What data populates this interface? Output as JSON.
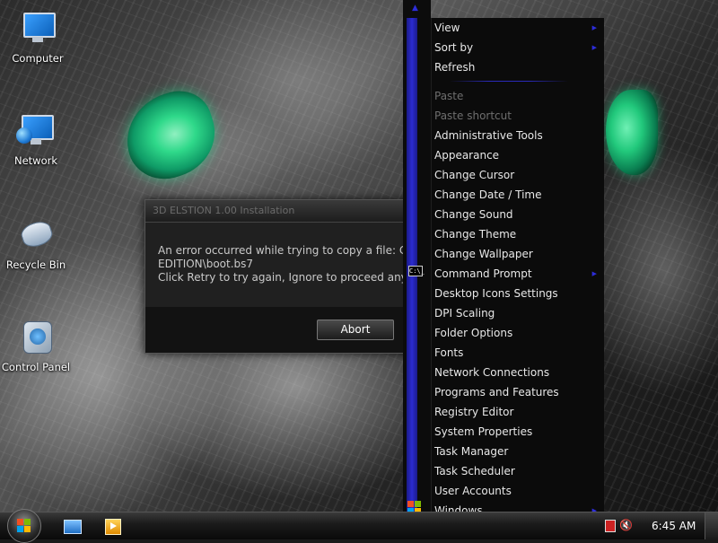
{
  "desktop": {
    "icons": [
      {
        "label": "Computer"
      },
      {
        "label": "Network"
      },
      {
        "label": "Recycle Bin"
      },
      {
        "label": "Control Panel"
      }
    ]
  },
  "dialog": {
    "title": "3D ELSTION 1.00 Installation",
    "message_line1": "An error occurred while trying to copy a file: C:\\Prog",
    "message_line2": "EDITION\\boot.bs7",
    "message_line3": "Click Retry to try again, Ignore to proceed anyway, o",
    "abort_label": "Abort"
  },
  "context_menu": {
    "items": [
      {
        "label": "View",
        "submenu": true,
        "enabled": true
      },
      {
        "label": "Sort by",
        "submenu": true,
        "enabled": true
      },
      {
        "label": "Refresh",
        "submenu": false,
        "enabled": true
      },
      {
        "separator": true
      },
      {
        "label": "Paste",
        "submenu": false,
        "enabled": false
      },
      {
        "label": "Paste shortcut",
        "submenu": false,
        "enabled": false
      },
      {
        "label": "Administrative Tools",
        "submenu": false,
        "enabled": true
      },
      {
        "label": "Appearance",
        "submenu": false,
        "enabled": true
      },
      {
        "label": "Change Cursor",
        "submenu": false,
        "enabled": true
      },
      {
        "label": "Change Date / Time",
        "submenu": false,
        "enabled": true
      },
      {
        "label": "Change Sound",
        "submenu": false,
        "enabled": true
      },
      {
        "label": "Change Theme",
        "submenu": false,
        "enabled": true
      },
      {
        "label": "Change Wallpaper",
        "submenu": false,
        "enabled": true
      },
      {
        "label": "Command Prompt",
        "submenu": true,
        "enabled": true
      },
      {
        "label": "Desktop Icons Settings",
        "submenu": false,
        "enabled": true
      },
      {
        "label": "DPI Scaling",
        "submenu": false,
        "enabled": true
      },
      {
        "label": "Folder Options",
        "submenu": false,
        "enabled": true
      },
      {
        "label": "Fonts",
        "submenu": false,
        "enabled": true
      },
      {
        "label": "Network Connections",
        "submenu": false,
        "enabled": true
      },
      {
        "label": "Programs and Features",
        "submenu": false,
        "enabled": true
      },
      {
        "label": "Registry Editor",
        "submenu": false,
        "enabled": true
      },
      {
        "label": "System Properties",
        "submenu": false,
        "enabled": true
      },
      {
        "label": "Task Manager",
        "submenu": false,
        "enabled": true
      },
      {
        "label": "Task Scheduler",
        "submenu": false,
        "enabled": true
      },
      {
        "label": "User Accounts",
        "submenu": false,
        "enabled": true
      },
      {
        "label": "Windows",
        "submenu": true,
        "enabled": true
      }
    ],
    "cmd_icon_text": "C:\\_"
  },
  "taskbar": {
    "clock": "6:45 AM"
  },
  "icons": {
    "start": "windows-logo-icon",
    "explorer": "folder-icon",
    "media": "media-player-icon",
    "network_tray": "network-status-icon",
    "volume_tray": "volume-muted-icon"
  },
  "colors": {
    "menu_accent": "#2d2dd8",
    "eye_green": "#2fd98a"
  }
}
